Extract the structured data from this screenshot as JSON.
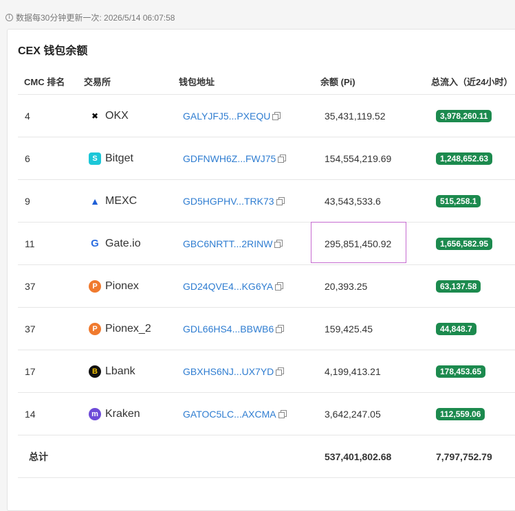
{
  "notice": "数据每30分钟更新一次: 2026/5/14 06:07:58",
  "card_title": "CEX 钱包余额",
  "columns": [
    "CMC 排名",
    "交易所",
    "钱包地址",
    "余额 (Pi)",
    "总流入（近24小时）"
  ],
  "rows": [
    {
      "rank": "4",
      "exchange": "OKX",
      "address": "GALYJFJ5...PXEQU",
      "balance": "35,431,119.52",
      "inflow": "3,978,260.11",
      "logo_icon": "okx-logo",
      "logo_color": "#000000"
    },
    {
      "rank": "6",
      "exchange": "Bitget",
      "address": "GDFNWH6Z...FWJ75",
      "balance": "154,554,219.69",
      "inflow": "1,248,652.63",
      "logo_icon": "bitget-logo",
      "logo_color": "#1cc7d8"
    },
    {
      "rank": "9",
      "exchange": "MEXC",
      "address": "GD5HGPHV...TRK73",
      "balance": "43,543,533.6",
      "inflow": "515,258.1",
      "logo_icon": "mexc-logo",
      "logo_color": "#1f5fd6"
    },
    {
      "rank": "11",
      "exchange": "Gate.io",
      "address": "GBC6NRTT...2RINW",
      "balance": "295,851,450.92",
      "inflow": "1,656,582.95",
      "logo_icon": "gateio-logo",
      "logo_color": "#2c6de0",
      "highlighted": true
    },
    {
      "rank": "37",
      "exchange": "Pionex",
      "address": "GD24QVE4...KG6YA",
      "balance": "20,393.25",
      "inflow": "63,137.58",
      "logo_icon": "pionex-logo",
      "logo_color": "#f07a2e"
    },
    {
      "rank": "37",
      "exchange": "Pionex_2",
      "address": "GDL66HS4...BBWB6",
      "balance": "159,425.45",
      "inflow": "44,848.7",
      "logo_icon": "pionex-logo",
      "logo_color": "#f07a2e"
    },
    {
      "rank": "17",
      "exchange": "Lbank",
      "address": "GBXHS6NJ...UX7YD",
      "balance": "4,199,413.21",
      "inflow": "178,453.65",
      "logo_icon": "lbank-logo",
      "logo_color": "#f2c200"
    },
    {
      "rank": "14",
      "exchange": "Kraken",
      "address": "GATOC5LC...AXCMA",
      "balance": "3,642,247.05",
      "inflow": "112,559.06",
      "logo_icon": "kraken-logo",
      "logo_color": "#6e4bd8"
    }
  ],
  "total": {
    "label": "总计",
    "balance": "537,401,802.68",
    "inflow": "7,797,752.79"
  },
  "colors": {
    "badge": "#1c8a4e",
    "link": "#2f7dd1",
    "highlight": "#c66bd0"
  }
}
